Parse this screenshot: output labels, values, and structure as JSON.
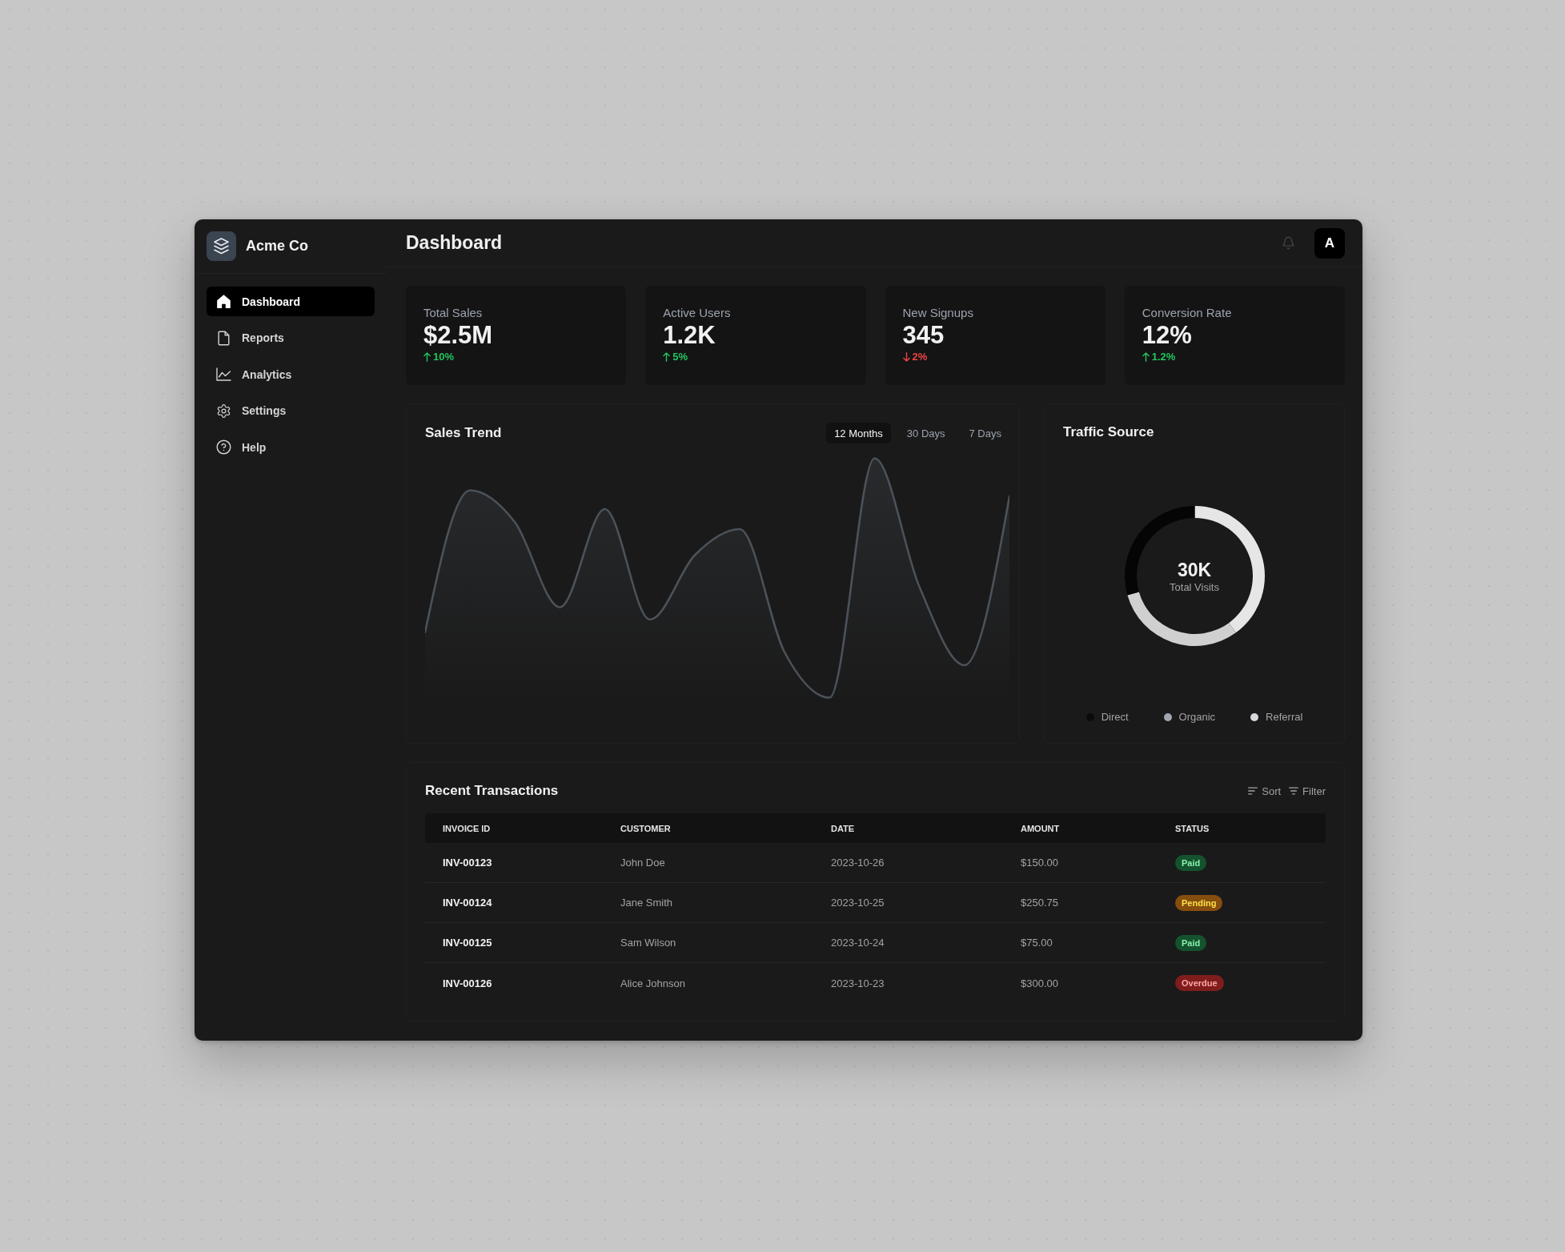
{
  "sidebar": {
    "brand": "Acme Co",
    "items": [
      {
        "label": "Dashboard",
        "selected": true
      },
      {
        "label": "Reports",
        "selected": false
      },
      {
        "label": "Analytics",
        "selected": false
      },
      {
        "label": "Settings",
        "selected": false
      },
      {
        "label": "Help",
        "selected": false
      }
    ]
  },
  "header": {
    "title": "Dashboard",
    "avatar": "A"
  },
  "stats": [
    {
      "label": "Total Sales",
      "value": "$2.5M",
      "change": "10%",
      "rising": true
    },
    {
      "label": "Active Users",
      "value": "1.2K",
      "change": "5%",
      "rising": true
    },
    {
      "label": "New Signups",
      "value": "345",
      "change": "2%",
      "rising": false
    },
    {
      "label": "Conversion Rate",
      "value": "12%",
      "change": "1.2%",
      "rising": true
    }
  ],
  "sales_trend": {
    "title": "Sales Trend",
    "tabs": [
      {
        "label": "12 Months",
        "selected": true
      },
      {
        "label": "30 Days",
        "selected": false
      },
      {
        "label": "7 Days",
        "selected": false
      }
    ]
  },
  "traffic_source": {
    "title": "Traffic Source",
    "total": "30K",
    "total_label": "Total Visits",
    "legend": [
      {
        "label": "Direct",
        "color": "#0a0a0a"
      },
      {
        "label": "Organic",
        "color": "#a1a6b0"
      },
      {
        "label": "Referral",
        "color": "#d6d8dc"
      }
    ]
  },
  "transactions": {
    "title": "Recent Transactions",
    "actions": [
      "Sort",
      "Filter"
    ],
    "columns": [
      "INVOICE ID",
      "CUSTOMER",
      "DATE",
      "AMOUNT",
      "STATUS"
    ],
    "rows": [
      {
        "invoice": "INV-00123",
        "customer": "John Doe",
        "date": "2023-10-26",
        "amount": "$150.00",
        "status": {
          "text": "Paid",
          "kind": "success"
        }
      },
      {
        "invoice": "INV-00124",
        "customer": "Jane Smith",
        "date": "2023-10-25",
        "amount": "$250.75",
        "status": {
          "text": "Pending",
          "kind": "warning"
        }
      },
      {
        "invoice": "INV-00125",
        "customer": "Sam Wilson",
        "date": "2023-10-24",
        "amount": "$75.00",
        "status": {
          "text": "Paid",
          "kind": "success"
        }
      },
      {
        "invoice": "INV-00126",
        "customer": "Alice Johnson",
        "date": "2023-10-23",
        "amount": "$300.00",
        "status": {
          "text": "Overdue",
          "kind": "danger"
        }
      }
    ]
  }
}
